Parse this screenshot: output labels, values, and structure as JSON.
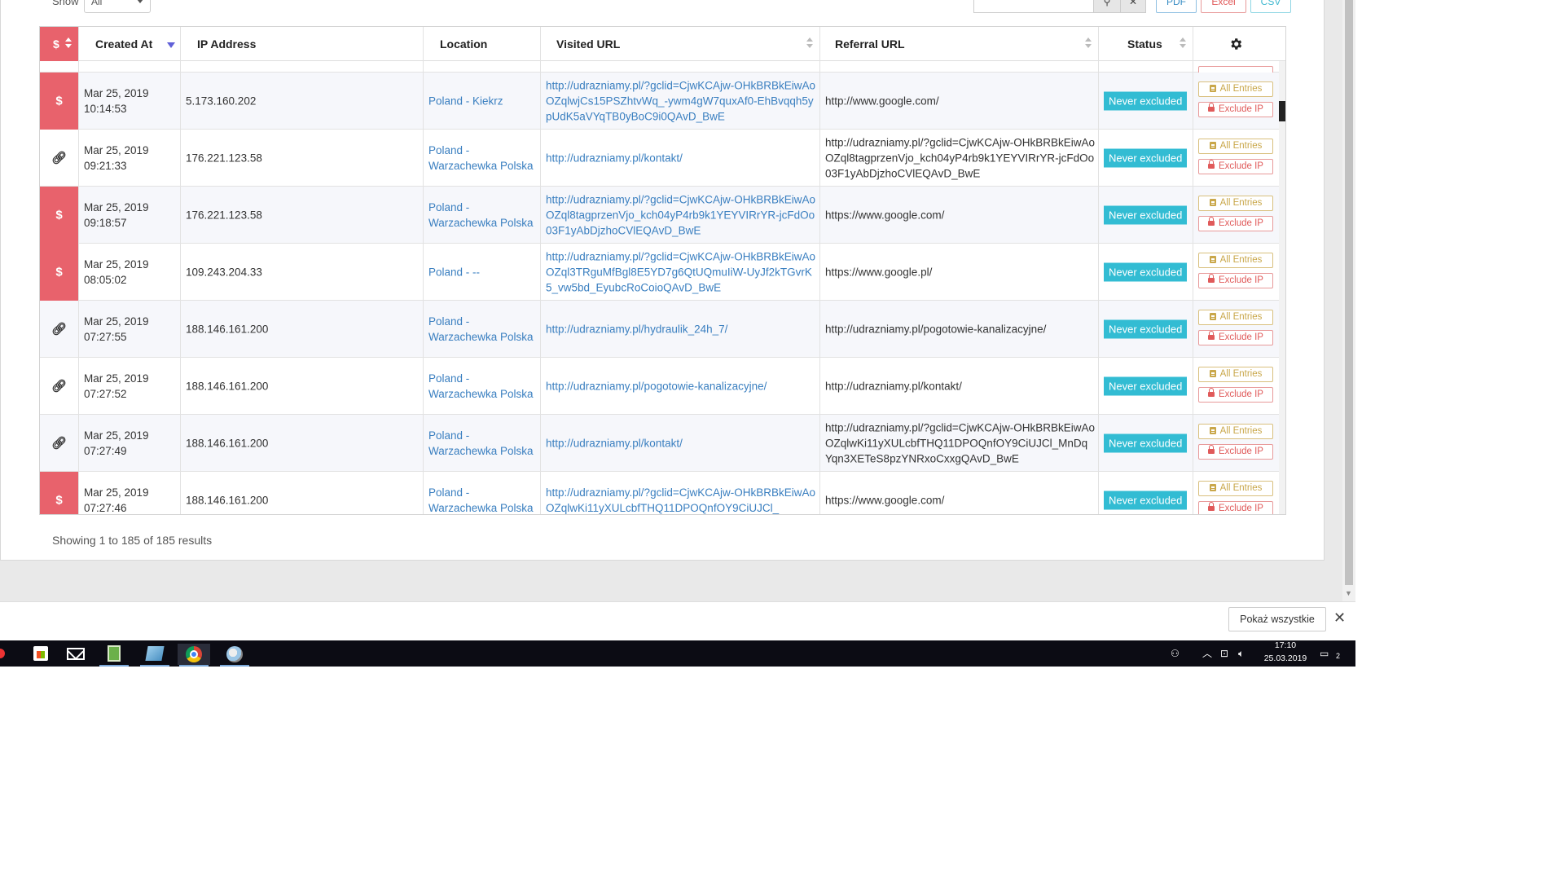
{
  "controls": {
    "show_label": "Show",
    "show_value": "All",
    "search_placeholder": "",
    "search_icon": "search-icon",
    "clear_icon": "close-icon",
    "export": {
      "pdf": "PDF",
      "excel": "Excel",
      "csv": "CSV"
    }
  },
  "table": {
    "headers": {
      "type": "$",
      "created_at": "Created At",
      "ip_address": "IP Address",
      "location": "Location",
      "visited_url": "Visited URL",
      "referral_url": "Referral URL",
      "status": "Status",
      "settings_icon": "gear-icon"
    },
    "rows": [
      {
        "type": "$",
        "type_icon": "dollar-icon",
        "date": "Mar 25, 2019",
        "time": "10:14:53",
        "ip": "5.173.160.202",
        "location": "Poland - Kiekrz",
        "visited_url": "http://udrazniamy.pl/?gclid=CjwKCAjw-OHkBRBkEiwAoOZqlwjCs15PSZhtvWq_-ywm4gW7quxAf0-EhBvqqh5ypUdK5aVYqTB0yBoC9i0QAvD_BwE",
        "referral_url": "http://www.google.com/",
        "status": "Never excluded",
        "all_entries": "All Entries",
        "exclude_ip": "Exclude IP"
      },
      {
        "type": "link",
        "type_icon": "link-icon",
        "date": "Mar 25, 2019",
        "time": "09:21:33",
        "ip": "176.221.123.58",
        "location": "Poland - Warzachewka Polska",
        "visited_url": "http://udrazniamy.pl/kontakt/",
        "referral_url": "http://udrazniamy.pl/?gclid=CjwKCAjw-OHkBRBkEiwAoOZql8tagprzenVjo_kch04yP4rb9k1YEYVIRrYR-jcFdOo03F1yAbDjzhoCVlEQAvD_BwE",
        "status": "Never excluded",
        "all_entries": "All Entries",
        "exclude_ip": "Exclude IP"
      },
      {
        "type": "$",
        "type_icon": "dollar-icon",
        "date": "Mar 25, 2019",
        "time": "09:18:57",
        "ip": "176.221.123.58",
        "location": "Poland - Warzachewka Polska",
        "visited_url": "http://udrazniamy.pl/?gclid=CjwKCAjw-OHkBRBkEiwAoOZql8tagprzenVjo_kch04yP4rb9k1YEYVIRrYR-jcFdOo03F1yAbDjzhoCVlEQAvD_BwE",
        "referral_url": "https://www.google.com/",
        "status": "Never excluded",
        "all_entries": "All Entries",
        "exclude_ip": "Exclude IP"
      },
      {
        "type": "$",
        "type_icon": "dollar-icon",
        "date": "Mar 25, 2019",
        "time": "08:05:02",
        "ip": "109.243.204.33",
        "location": "Poland - --",
        "visited_url": "http://udrazniamy.pl/?gclid=CjwKCAjw-OHkBRBkEiwAoOZql3TRguMfBgl8E5YD7g6QtUQmuIiW-UyJf2kTGvrK5_vw5bd_EyubcRoCoioQAvD_BwE",
        "referral_url": "https://www.google.pl/",
        "status": "Never excluded",
        "all_entries": "All Entries",
        "exclude_ip": "Exclude IP"
      },
      {
        "type": "link",
        "type_icon": "link-icon",
        "date": "Mar 25, 2019",
        "time": "07:27:55",
        "ip": "188.146.161.200",
        "location": "Poland - Warzachewka Polska",
        "visited_url": "http://udrazniamy.pl/hydraulik_24h_7/",
        "referral_url": "http://udrazniamy.pl/pogotowie-kanalizacyjne/",
        "status": "Never excluded",
        "all_entries": "All Entries",
        "exclude_ip": "Exclude IP"
      },
      {
        "type": "link",
        "type_icon": "link-icon",
        "date": "Mar 25, 2019",
        "time": "07:27:52",
        "ip": "188.146.161.200",
        "location": "Poland - Warzachewka Polska",
        "visited_url": "http://udrazniamy.pl/pogotowie-kanalizacyjne/",
        "referral_url": "http://udrazniamy.pl/kontakt/",
        "status": "Never excluded",
        "all_entries": "All Entries",
        "exclude_ip": "Exclude IP"
      },
      {
        "type": "link",
        "type_icon": "link-icon",
        "date": "Mar 25, 2019",
        "time": "07:27:49",
        "ip": "188.146.161.200",
        "location": "Poland - Warzachewka Polska",
        "visited_url": "http://udrazniamy.pl/kontakt/",
        "referral_url": "http://udrazniamy.pl/?gclid=CjwKCAjw-OHkBRBkEiwAoOZqlwKi11yXULcbfTHQ11DPOQnfOY9CiUJCl_MnDqYqn3XETeS8pzYNRxoCxxgQAvD_BwE",
        "status": "Never excluded",
        "all_entries": "All Entries",
        "exclude_ip": "Exclude IP"
      },
      {
        "type": "$",
        "type_icon": "dollar-icon",
        "date": "Mar 25, 2019",
        "time": "07:27:46",
        "ip": "188.146.161.200",
        "location": "Poland - Warzachewka Polska",
        "visited_url": "http://udrazniamy.pl/?gclid=CjwKCAjw-OHkBRBkEiwAoOZqlwKi11yXULcbfTHQ11DPOQnfOY9CiUJCl_",
        "referral_url": "https://www.google.com/",
        "status": "Never excluded",
        "all_entries": "All Entries",
        "exclude_ip": "Exclude IP"
      }
    ]
  },
  "footer": {
    "summary": "Showing 1 to 185 of 185 results"
  },
  "download_bar": {
    "show_all": "Pokaż wszystkie",
    "close_icon": "close-icon"
  },
  "taskbar": {
    "apps": [
      "store-icon",
      "mail-icon",
      "notepad-icon",
      "files-icon",
      "chrome-icon",
      "paint-icon"
    ],
    "clock_time": "17:10",
    "clock_date": "25.03.2019",
    "notification_count": "2"
  },
  "colors": {
    "accent_red": "#e8626c",
    "badge_teal": "#32bcd3",
    "link_blue": "#3a7fc0",
    "gold": "#c9a74a"
  }
}
